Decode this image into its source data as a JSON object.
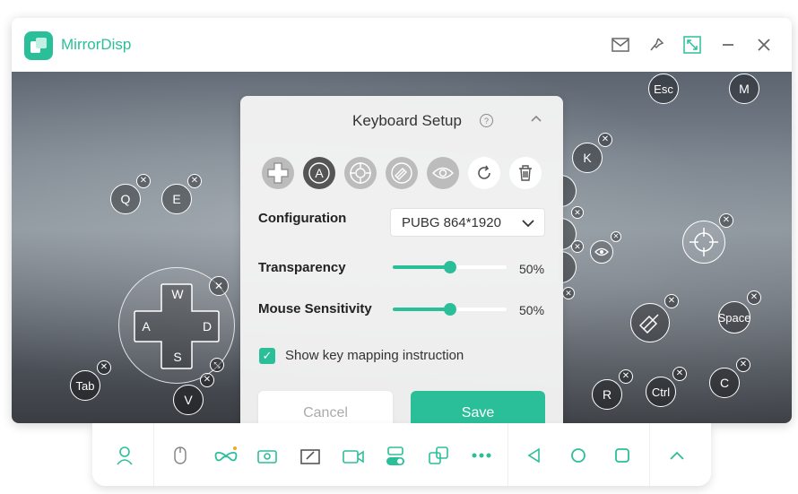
{
  "app": {
    "title": "MirrorDisp"
  },
  "keys": {
    "q": "Q",
    "e": "E",
    "w": "W",
    "a": "A",
    "s": "S",
    "d": "D",
    "tab": "Tab",
    "v": "V",
    "esc": "Esc",
    "m": "M",
    "k": "K",
    "space": "Space",
    "ctrl": "Ctrl",
    "r": "R",
    "c": "C"
  },
  "panel": {
    "title": "Keyboard Setup",
    "help": "?",
    "configuration_label": "Configuration",
    "configuration_value": "PUBG 864*1920",
    "transparency_label": "Transparency",
    "transparency_value": "50%",
    "transparency_fraction": 0.5,
    "mouse_label": "Mouse Sensitivity",
    "mouse_value": "50%",
    "mouse_fraction": 0.5,
    "show_mapping_label": "Show key mapping instruction",
    "show_mapping_checked": true,
    "cancel_label": "Cancel",
    "save_label": "Save"
  },
  "colors": {
    "accent": "#2bbf99"
  }
}
